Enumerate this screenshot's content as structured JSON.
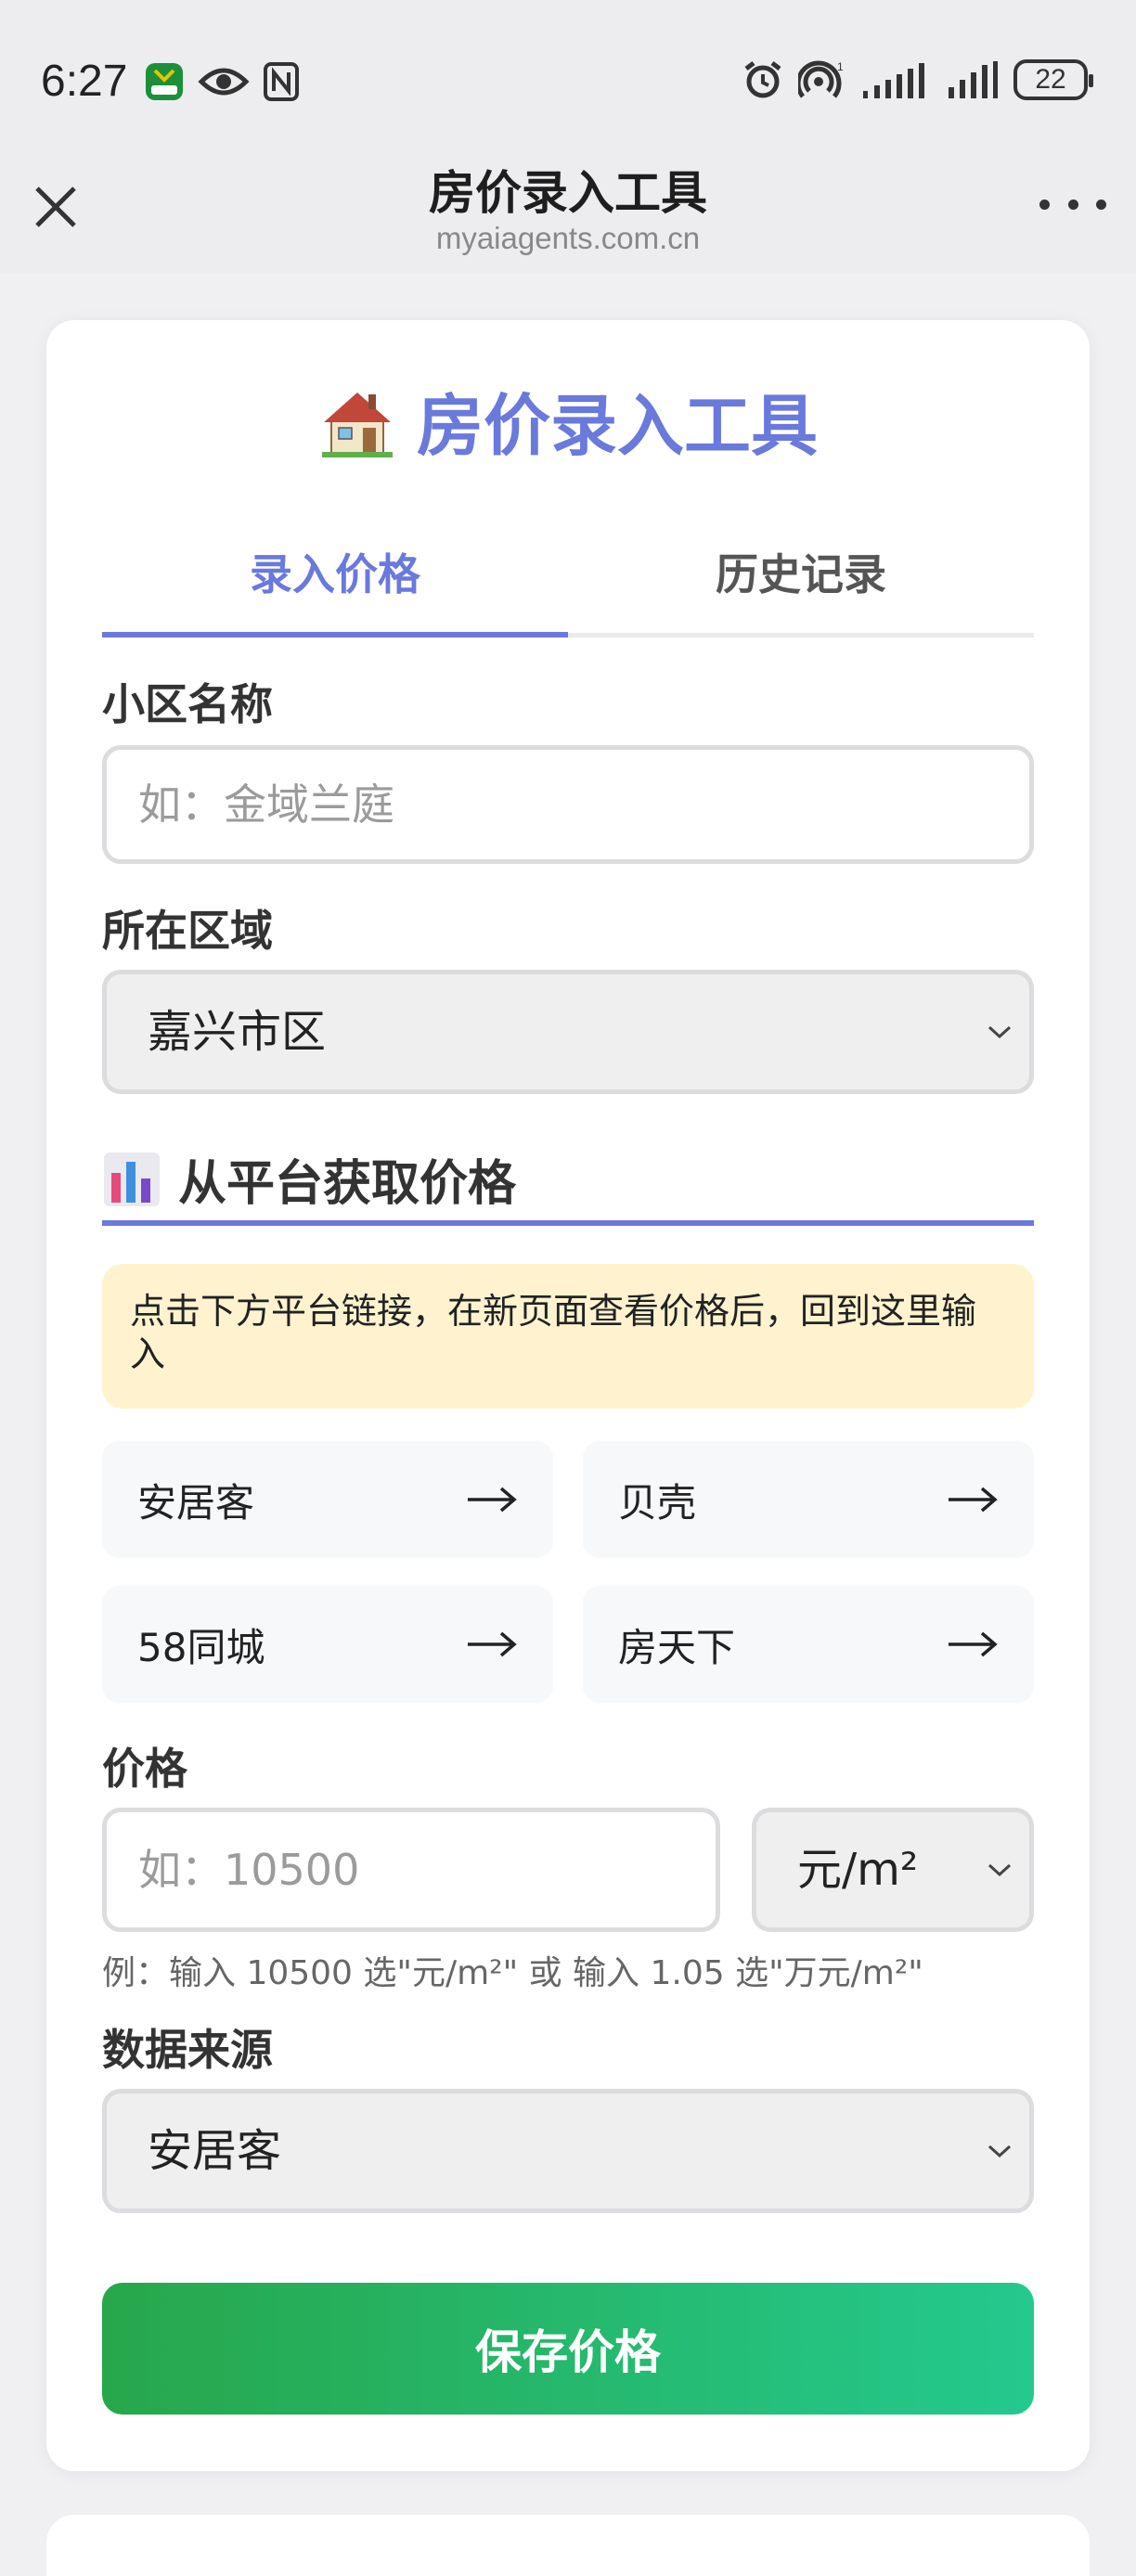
{
  "status_bar": {
    "time": "6:27",
    "battery": "22",
    "icons": [
      "post-app-icon",
      "eye-icon",
      "nfc-icon",
      "alarm-icon",
      "hotspot-icon",
      "signal-icon",
      "signal-icon",
      "battery-icon"
    ]
  },
  "title_bar": {
    "title": "房价录入工具",
    "url": "myaiagents.com.cn"
  },
  "app": {
    "title": "房价录入工具",
    "tabs": [
      {
        "label": "录入价格",
        "active": true
      },
      {
        "label": "历史记录",
        "active": false
      }
    ]
  },
  "form": {
    "community_label": "小区名称",
    "community_placeholder": "如：金域兰庭",
    "district_label": "所在区域",
    "district_value": "嘉兴市区",
    "section_title": "从平台获取价格",
    "notice": "点击下方平台链接，在新页面查看价格后，回到这里输入",
    "platforms": [
      "安居客",
      "贝壳",
      "58同城",
      "房天下"
    ],
    "price_label": "价格",
    "price_placeholder": "如：10500",
    "unit_value": "元/m²",
    "hint": "例：输入 10500 选\"元/m²\" 或 输入 1.05 选\"万元/m²\"",
    "source_label": "数据来源",
    "source_value": "安居客",
    "save_button": "保存价格"
  },
  "colors": {
    "accent": "#6a79dc",
    "notice_bg": "#fff3cf",
    "button_start": "#27a74b",
    "button_end": "#24c98e"
  }
}
